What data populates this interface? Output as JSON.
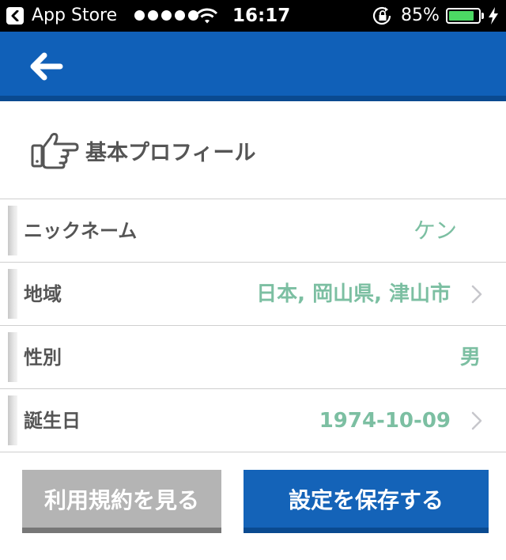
{
  "status_bar": {
    "back_app": "App Store",
    "time": "16:17",
    "battery_pct": "85%",
    "battery_level": 0.85,
    "battery_color": "#4cd964"
  },
  "nav": {
    "back_icon": "back-arrow-icon",
    "color": "#1060b8"
  },
  "section": {
    "icon": "pointing-hand-icon",
    "title": "基本プロフィール"
  },
  "rows": [
    {
      "label": "ニックネーム",
      "value": "ケン",
      "chevron": false
    },
    {
      "label": "地域",
      "value": "日本, 岡山県, 津山市",
      "chevron": true
    },
    {
      "label": "性別",
      "value": "男",
      "chevron": false
    },
    {
      "label": "誕生日",
      "value": "1974-10-09",
      "chevron": true
    }
  ],
  "buttons": {
    "terms": "利用規約を見る",
    "save": "設定を保存する"
  },
  "colors": {
    "value_text": "#7cbfa2",
    "label_text": "#555555",
    "save_button": "#1463b8",
    "terms_button": "#b4b4b4"
  }
}
